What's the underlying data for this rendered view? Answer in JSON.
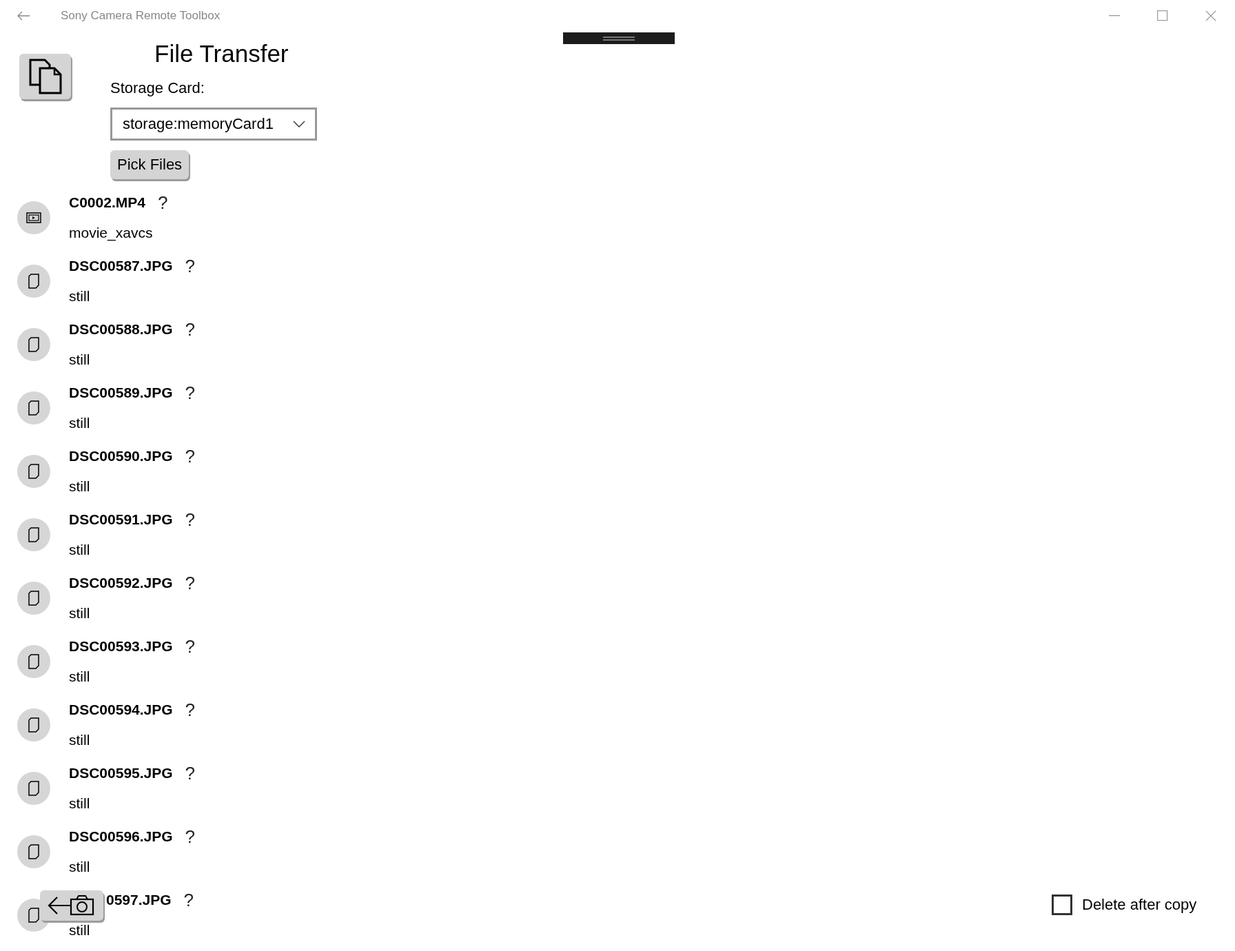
{
  "window": {
    "title": "Sony Camera Remote Toolbox"
  },
  "page": {
    "title": "File Transfer",
    "storage_label": "Storage Card:",
    "storage_value": "storage:memoryCard1",
    "pick_button": "Pick Files"
  },
  "files": [
    {
      "kind": "movie",
      "name": "C0002.MP4",
      "status": "?",
      "type": "movie_xavcs",
      "covered": false
    },
    {
      "kind": "still",
      "name": "DSC00587.JPG",
      "status": "?",
      "type": "still",
      "covered": false
    },
    {
      "kind": "still",
      "name": "DSC00588.JPG",
      "status": "?",
      "type": "still",
      "covered": false
    },
    {
      "kind": "still",
      "name": "DSC00589.JPG",
      "status": "?",
      "type": "still",
      "covered": false
    },
    {
      "kind": "still",
      "name": "DSC00590.JPG",
      "status": "?",
      "type": "still",
      "covered": false
    },
    {
      "kind": "still",
      "name": "DSC00591.JPG",
      "status": "?",
      "type": "still",
      "covered": false
    },
    {
      "kind": "still",
      "name": "DSC00592.JPG",
      "status": "?",
      "type": "still",
      "covered": false
    },
    {
      "kind": "still",
      "name": "DSC00593.JPG",
      "status": "?",
      "type": "still",
      "covered": false
    },
    {
      "kind": "still",
      "name": "DSC00594.JPG",
      "status": "?",
      "type": "still",
      "covered": false
    },
    {
      "kind": "still",
      "name": "DSC00595.JPG",
      "status": "?",
      "type": "still",
      "covered": false
    },
    {
      "kind": "still",
      "name": "DSC00596.JPG",
      "status": "?",
      "type": "still",
      "covered": false
    },
    {
      "kind": "still",
      "name": "0597.JPG",
      "status": "?",
      "type": "still",
      "covered": true
    }
  ],
  "delete_after_copy": {
    "label": "Delete after copy",
    "checked": false
  }
}
